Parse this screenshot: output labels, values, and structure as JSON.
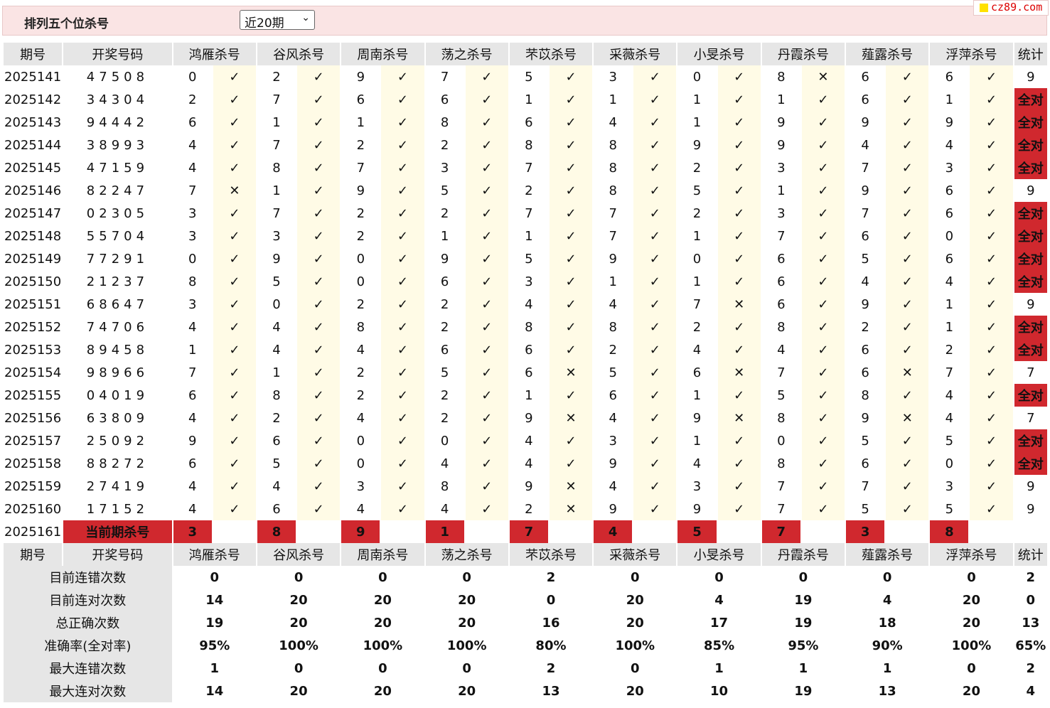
{
  "header": {
    "title": "排列五个位杀号",
    "period_select": "近20期",
    "watermark": "cz89.com"
  },
  "columns": {
    "period": "期号",
    "draw": "开奖号码",
    "stat": "统计",
    "experts": [
      "鸿雁杀号",
      "谷风杀号",
      "周南杀号",
      "荡之杀号",
      "芣苡杀号",
      "采薇杀号",
      "小旻杀号",
      "丹霞杀号",
      "薤露杀号",
      "浮萍杀号"
    ]
  },
  "rows": [
    {
      "period": "2025141",
      "draw": "47508",
      "kills": [
        "0",
        "2",
        "9",
        "7",
        "5",
        "3",
        "0",
        "8",
        "6",
        "6"
      ],
      "ok": [
        1,
        1,
        1,
        1,
        1,
        1,
        1,
        0,
        1,
        1
      ],
      "stat": "9"
    },
    {
      "period": "2025142",
      "draw": "34304",
      "kills": [
        "2",
        "7",
        "6",
        "6",
        "1",
        "1",
        "1",
        "1",
        "6",
        "1"
      ],
      "ok": [
        1,
        1,
        1,
        1,
        1,
        1,
        1,
        1,
        1,
        1
      ],
      "stat": "全对"
    },
    {
      "period": "2025143",
      "draw": "94442",
      "kills": [
        "6",
        "1",
        "1",
        "8",
        "6",
        "4",
        "1",
        "9",
        "9",
        "9"
      ],
      "ok": [
        1,
        1,
        1,
        1,
        1,
        1,
        1,
        1,
        1,
        1
      ],
      "stat": "全对"
    },
    {
      "period": "2025144",
      "draw": "38993",
      "kills": [
        "4",
        "7",
        "2",
        "2",
        "8",
        "8",
        "9",
        "9",
        "4",
        "4"
      ],
      "ok": [
        1,
        1,
        1,
        1,
        1,
        1,
        1,
        1,
        1,
        1
      ],
      "stat": "全对"
    },
    {
      "period": "2025145",
      "draw": "47159",
      "kills": [
        "4",
        "8",
        "7",
        "3",
        "7",
        "8",
        "2",
        "3",
        "7",
        "3"
      ],
      "ok": [
        1,
        1,
        1,
        1,
        1,
        1,
        1,
        1,
        1,
        1
      ],
      "stat": "全对"
    },
    {
      "period": "2025146",
      "draw": "82247",
      "kills": [
        "7",
        "1",
        "9",
        "5",
        "2",
        "8",
        "5",
        "1",
        "9",
        "6"
      ],
      "ok": [
        0,
        1,
        1,
        1,
        1,
        1,
        1,
        1,
        1,
        1
      ],
      "stat": "9"
    },
    {
      "period": "2025147",
      "draw": "02305",
      "kills": [
        "3",
        "7",
        "2",
        "2",
        "7",
        "7",
        "2",
        "3",
        "7",
        "6"
      ],
      "ok": [
        1,
        1,
        1,
        1,
        1,
        1,
        1,
        1,
        1,
        1
      ],
      "stat": "全对"
    },
    {
      "period": "2025148",
      "draw": "55704",
      "kills": [
        "3",
        "3",
        "2",
        "1",
        "1",
        "7",
        "1",
        "7",
        "6",
        "0"
      ],
      "ok": [
        1,
        1,
        1,
        1,
        1,
        1,
        1,
        1,
        1,
        1
      ],
      "stat": "全对"
    },
    {
      "period": "2025149",
      "draw": "77291",
      "kills": [
        "0",
        "9",
        "0",
        "9",
        "5",
        "9",
        "0",
        "6",
        "5",
        "6"
      ],
      "ok": [
        1,
        1,
        1,
        1,
        1,
        1,
        1,
        1,
        1,
        1
      ],
      "stat": "全对"
    },
    {
      "period": "2025150",
      "draw": "21237",
      "kills": [
        "8",
        "5",
        "0",
        "6",
        "3",
        "1",
        "1",
        "6",
        "4",
        "4"
      ],
      "ok": [
        1,
        1,
        1,
        1,
        1,
        1,
        1,
        1,
        1,
        1
      ],
      "stat": "全对"
    },
    {
      "period": "2025151",
      "draw": "68647",
      "kills": [
        "3",
        "0",
        "2",
        "2",
        "4",
        "4",
        "7",
        "6",
        "9",
        "1"
      ],
      "ok": [
        1,
        1,
        1,
        1,
        1,
        1,
        0,
        1,
        1,
        1
      ],
      "stat": "9"
    },
    {
      "period": "2025152",
      "draw": "74706",
      "kills": [
        "4",
        "4",
        "8",
        "2",
        "8",
        "8",
        "2",
        "8",
        "2",
        "1"
      ],
      "ok": [
        1,
        1,
        1,
        1,
        1,
        1,
        1,
        1,
        1,
        1
      ],
      "stat": "全对"
    },
    {
      "period": "2025153",
      "draw": "89458",
      "kills": [
        "1",
        "4",
        "4",
        "6",
        "6",
        "2",
        "4",
        "4",
        "6",
        "2"
      ],
      "ok": [
        1,
        1,
        1,
        1,
        1,
        1,
        1,
        1,
        1,
        1
      ],
      "stat": "全对"
    },
    {
      "period": "2025154",
      "draw": "98966",
      "kills": [
        "7",
        "1",
        "2",
        "5",
        "6",
        "5",
        "6",
        "7",
        "6",
        "7"
      ],
      "ok": [
        1,
        1,
        1,
        1,
        0,
        1,
        0,
        1,
        0,
        1
      ],
      "stat": "7"
    },
    {
      "period": "2025155",
      "draw": "04019",
      "kills": [
        "6",
        "8",
        "2",
        "2",
        "1",
        "6",
        "1",
        "5",
        "8",
        "4"
      ],
      "ok": [
        1,
        1,
        1,
        1,
        1,
        1,
        1,
        1,
        1,
        1
      ],
      "stat": "全对"
    },
    {
      "period": "2025156",
      "draw": "63809",
      "kills": [
        "4",
        "2",
        "4",
        "2",
        "9",
        "4",
        "9",
        "8",
        "9",
        "4"
      ],
      "ok": [
        1,
        1,
        1,
        1,
        0,
        1,
        0,
        1,
        0,
        1
      ],
      "stat": "7"
    },
    {
      "period": "2025157",
      "draw": "25092",
      "kills": [
        "9",
        "6",
        "0",
        "0",
        "4",
        "3",
        "1",
        "0",
        "5",
        "5"
      ],
      "ok": [
        1,
        1,
        1,
        1,
        1,
        1,
        1,
        1,
        1,
        1
      ],
      "stat": "全对"
    },
    {
      "period": "2025158",
      "draw": "88272",
      "kills": [
        "6",
        "5",
        "0",
        "4",
        "4",
        "9",
        "4",
        "8",
        "6",
        "0"
      ],
      "ok": [
        1,
        1,
        1,
        1,
        1,
        1,
        1,
        1,
        1,
        1
      ],
      "stat": "全对"
    },
    {
      "period": "2025159",
      "draw": "27419",
      "kills": [
        "4",
        "4",
        "3",
        "8",
        "9",
        "4",
        "3",
        "7",
        "7",
        "3"
      ],
      "ok": [
        1,
        1,
        1,
        1,
        0,
        1,
        1,
        1,
        1,
        1
      ],
      "stat": "9"
    },
    {
      "period": "2025160",
      "draw": "17152",
      "kills": [
        "4",
        "6",
        "4",
        "4",
        "2",
        "9",
        "9",
        "7",
        "5",
        "5"
      ],
      "ok": [
        1,
        1,
        1,
        1,
        0,
        1,
        1,
        1,
        1,
        1
      ],
      "stat": "9"
    }
  ],
  "current": {
    "period": "2025161",
    "label": "当前期杀号",
    "kills": [
      "3",
      "8",
      "9",
      "1",
      "7",
      "4",
      "5",
      "7",
      "3",
      "8"
    ]
  },
  "summary": [
    {
      "label": "目前连错次数",
      "values": [
        "0",
        "0",
        "0",
        "0",
        "2",
        "0",
        "0",
        "0",
        "0",
        "0"
      ],
      "stat": "2",
      "color": "blue"
    },
    {
      "label": "目前连对次数",
      "values": [
        "14",
        "20",
        "20",
        "20",
        "0",
        "20",
        "4",
        "19",
        "4",
        "20"
      ],
      "stat": "0",
      "color": "blue"
    },
    {
      "label": "总正确次数",
      "values": [
        "19",
        "20",
        "20",
        "20",
        "16",
        "20",
        "17",
        "19",
        "18",
        "20"
      ],
      "stat": "13",
      "color": "blue"
    },
    {
      "label": "准确率(全对率)",
      "values": [
        "95%",
        "100%",
        "100%",
        "100%",
        "80%",
        "100%",
        "85%",
        "95%",
        "90%",
        "100%"
      ],
      "stat": "65%",
      "color": "red"
    },
    {
      "label": "最大连错次数",
      "values": [
        "1",
        "0",
        "0",
        "0",
        "2",
        "0",
        "1",
        "1",
        "1",
        "0"
      ],
      "stat": "2",
      "color": "blue"
    },
    {
      "label": "最大连对次数",
      "values": [
        "14",
        "20",
        "20",
        "20",
        "13",
        "20",
        "10",
        "19",
        "13",
        "20"
      ],
      "stat": "4",
      "color": "blue"
    }
  ],
  "marks": {
    "ok": "✓",
    "bad": "✕"
  }
}
